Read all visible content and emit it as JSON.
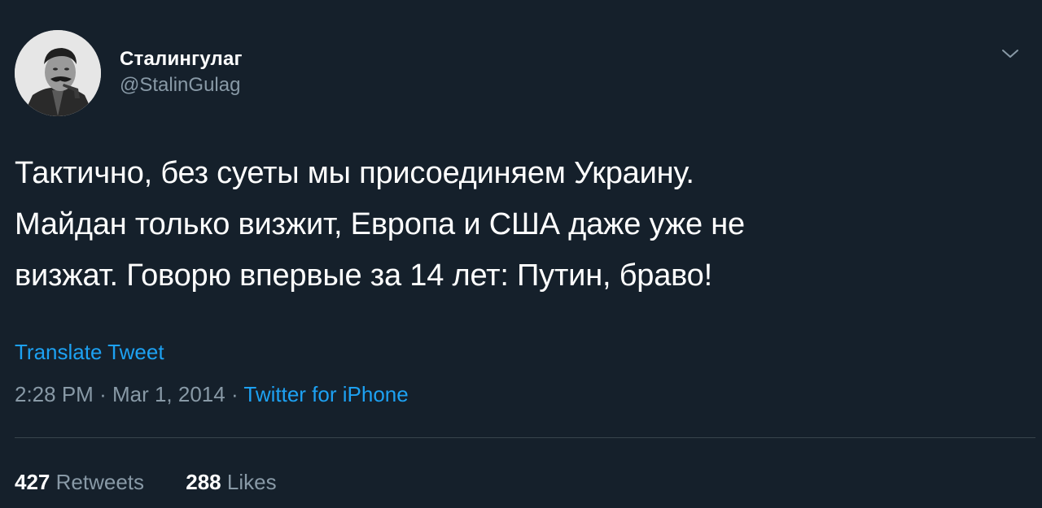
{
  "author": {
    "display_name": "Сталингулаг",
    "handle": "@StalinGulag"
  },
  "tweet": {
    "lines": [
      "Тактично, без суеты мы присоединяем Украину.",
      "Майдан только визжит, Европа и США даже уже не",
      "визжат. Говорю впервые за 14 лет: Путин, браво!"
    ],
    "translate_label": "Translate Tweet",
    "time": "2:28 PM",
    "date": "Mar 1, 2014",
    "separator": "·",
    "source": "Twitter for iPhone"
  },
  "stats": {
    "retweets_count": "427",
    "retweets_label": "Retweets",
    "likes_count": "288",
    "likes_label": "Likes"
  },
  "icons": {
    "menu": "chevron-down-icon",
    "avatar": "avatar"
  },
  "colors": {
    "background": "#15202b",
    "text": "#ffffff",
    "secondary": "#8899a6",
    "link": "#1da1f2",
    "divider": "#38444d"
  }
}
